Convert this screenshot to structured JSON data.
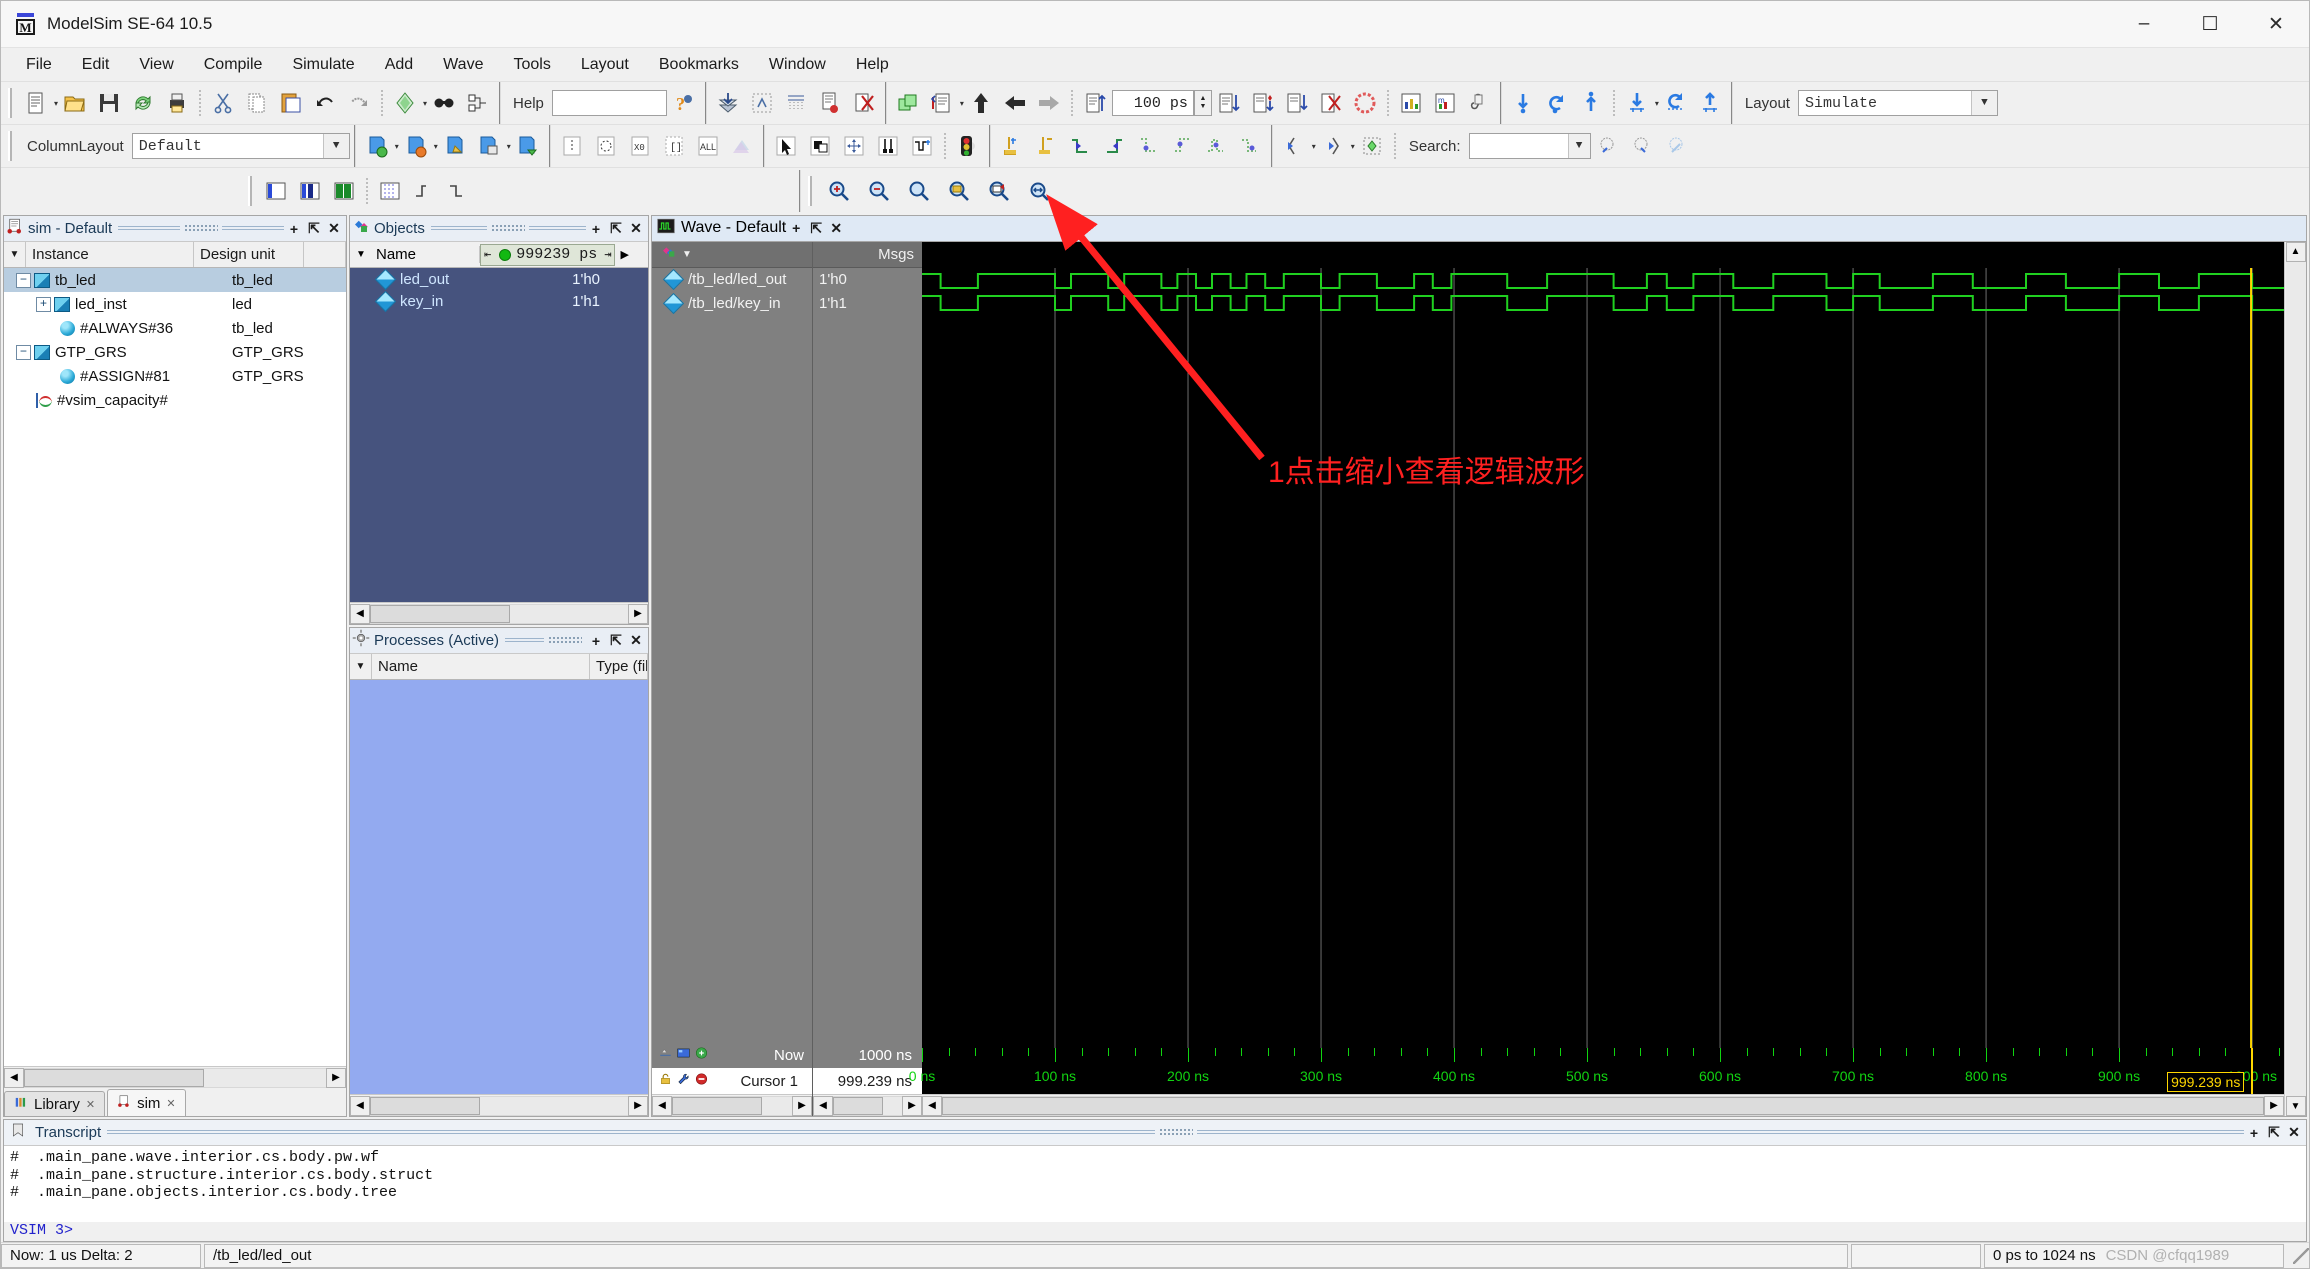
{
  "window": {
    "title": "ModelSim SE-64 10.5",
    "app_icon": "modelsim-icon",
    "minimize": "–",
    "maximize": "☐",
    "close": "✕"
  },
  "menubar": [
    {
      "label": "File"
    },
    {
      "label": "Edit"
    },
    {
      "label": "View"
    },
    {
      "label": "Compile"
    },
    {
      "label": "Simulate"
    },
    {
      "label": "Add"
    },
    {
      "label": "Wave"
    },
    {
      "label": "Tools"
    },
    {
      "label": "Layout"
    },
    {
      "label": "Bookmarks"
    },
    {
      "label": "Window"
    },
    {
      "label": "Help"
    }
  ],
  "toolbar1": {
    "help_label": "Help",
    "help_value": "",
    "run_length_value": "100 ps",
    "layout_label": "Layout",
    "layout_value": "Simulate"
  },
  "toolbar2": {
    "columnlayout_label": "ColumnLayout",
    "columnlayout_value": "Default",
    "search_label": "Search:",
    "search_value": "",
    "search_placeholder": ""
  },
  "sim_panel": {
    "title": "sim - Default",
    "columns": [
      "Instance",
      "Design unit",
      ""
    ],
    "rows": [
      {
        "indent": 0,
        "expander": "−",
        "icon": "block-icon",
        "instance": "tb_led",
        "design_unit": "tb_led",
        "selected": true
      },
      {
        "indent": 1,
        "expander": "+",
        "icon": "block-icon",
        "instance": "led_inst",
        "design_unit": "led",
        "selected": false
      },
      {
        "indent": 2,
        "expander": "",
        "icon": "process-icon",
        "instance": "#ALWAYS#36",
        "design_unit": "tb_led",
        "selected": false
      },
      {
        "indent": 0,
        "expander": "−",
        "icon": "block-icon",
        "instance": "GTP_GRS",
        "design_unit": "GTP_GRS",
        "selected": false
      },
      {
        "indent": 2,
        "expander": "",
        "icon": "process-icon",
        "instance": "#ASSIGN#81",
        "design_unit": "GTP_GRS",
        "selected": false
      },
      {
        "indent": 1,
        "expander": "",
        "icon": "capacity-icon",
        "instance": "#vsim_capacity#",
        "design_unit": "",
        "selected": false
      }
    ],
    "tabs": [
      {
        "label": "Library",
        "icon": "library-icon",
        "active": false
      },
      {
        "label": "sim",
        "icon": "sim-icon",
        "active": true
      }
    ]
  },
  "objects_panel": {
    "title": "Objects",
    "name_column": "Name",
    "time_value": "999239 ps",
    "rows": [
      {
        "name": "led_out",
        "value": "1'h0"
      },
      {
        "name": "key_in",
        "value": "1'h1"
      }
    ]
  },
  "processes_panel": {
    "title": "Processes (Active)",
    "columns": [
      "Name",
      "Type (filt"
    ],
    "rows": []
  },
  "wave_panel": {
    "title": "Wave - Default",
    "msgs_header": "Msgs",
    "signals": [
      {
        "name": "/tb_led/led_out",
        "value": "1'h0"
      },
      {
        "name": "/tb_led/key_in",
        "value": "1'h1"
      }
    ],
    "now_label": "Now",
    "now_value": "1000 ns",
    "cursor_label": "Cursor 1",
    "cursor_value": "999.239 ns",
    "cursor_flag": "999.239 ns",
    "axis_labels": [
      "0 ns",
      "100 ns",
      "200 ns",
      "300 ns",
      "400 ns",
      "500 ns",
      "600 ns",
      "700 ns",
      "800 ns",
      "900 ns",
      "1000 ns"
    ],
    "axis_min_ns": 0,
    "axis_max_ns": 1024
  },
  "annotation": {
    "text": "1点击缩小查看逻辑波形",
    "color": "#ff2020"
  },
  "transcript": {
    "title": "Transcript",
    "lines": [
      "#  .main_pane.wave.interior.cs.body.pw.wf",
      "#  .main_pane.structure.interior.cs.body.struct",
      "#  .main_pane.objects.interior.cs.body.tree"
    ],
    "prompt": "VSIM 3>"
  },
  "statusbar": {
    "now": "Now: 1 us  Delta: 2",
    "path": "/tb_led/led_out",
    "range": "0 ps to 1024 ns",
    "watermark": "CSDN @cfqq1989"
  },
  "colors": {
    "wave_trace": "#20d020",
    "cursor": "#ffd700",
    "objects_bg": "#46537e",
    "selection": "#b8cde0",
    "annotation": "#ff2020"
  },
  "wave_data": {
    "time_unit": "ns",
    "led_out_transitions": [
      0,
      14,
      42,
      100,
      112,
      140,
      152,
      180,
      192,
      206,
      218,
      232,
      244,
      258,
      272,
      300,
      314,
      342,
      370,
      384,
      398,
      440,
      470,
      520,
      545,
      560,
      580,
      610,
      640,
      680,
      700,
      720,
      760,
      790,
      830,
      860,
      900,
      930,
      960,
      1000
    ],
    "key_in_transitions": [
      0,
      14,
      42,
      100,
      112,
      140,
      152,
      180,
      192,
      206,
      218,
      232,
      244,
      258,
      272,
      300,
      314,
      342,
      370,
      384,
      398,
      440,
      470,
      520,
      545,
      560,
      580,
      610,
      640,
      680,
      700,
      720,
      760,
      790,
      830,
      860,
      900,
      930,
      960,
      1000
    ]
  }
}
